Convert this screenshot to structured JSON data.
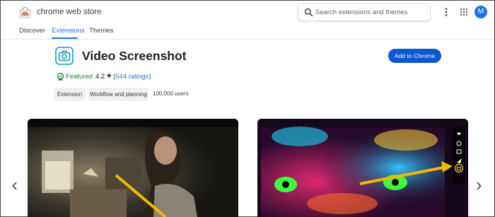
{
  "header": {
    "brand": "chrome web store",
    "search": {
      "placeholder": "Search extensions and themes"
    },
    "avatar_letter": "M"
  },
  "nav": {
    "tabs": [
      {
        "label": "Discover",
        "active": false
      },
      {
        "label": "Extensions",
        "active": true
      },
      {
        "label": "Themes",
        "active": false
      }
    ]
  },
  "extension": {
    "title": "Video Screenshot",
    "add_button": "Add to Chrome",
    "featured": "Featured",
    "rating": "4.2",
    "rating_count_link": "544 ratings",
    "chips": [
      "Extension",
      "Workflow and planning"
    ],
    "users": "100,000 users"
  },
  "carousel": {
    "screenshots": [
      {
        "subject": "woman-at-desk-scene"
      },
      {
        "subject": "painted-face-with-icons"
      }
    ]
  },
  "colors": {
    "accent": "#1a73e8",
    "button": "#0b57d0",
    "featured_green": "#188038",
    "arrow_yellow": "#f5b800"
  }
}
